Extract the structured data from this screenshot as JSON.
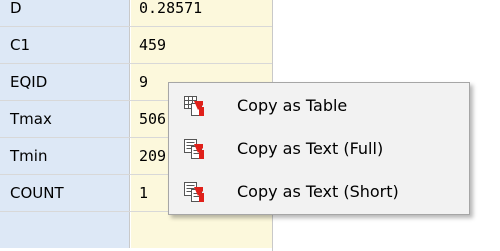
{
  "grid": {
    "rows": [
      {
        "name": "D",
        "value": "0.28571"
      },
      {
        "name": "C1",
        "value": "459"
      },
      {
        "name": "EQID",
        "value": "9"
      },
      {
        "name": "Tmax",
        "value": "506"
      },
      {
        "name": "Tmin",
        "value": "209"
      },
      {
        "name": "COUNT",
        "value": "1"
      }
    ]
  },
  "context_menu": {
    "items": [
      {
        "label": "Copy as Table",
        "icon": "table-copy-icon"
      },
      {
        "label": "Copy as Text (Full)",
        "icon": "text-copy-icon"
      },
      {
        "label": "Copy as Text (Short)",
        "icon": "text-copy-icon"
      }
    ]
  },
  "colors": {
    "name_column_bg": "#dde8f6",
    "value_column_bg": "#fcf8dc",
    "menu_bg": "#f2f2f2",
    "icon_accent": "#e0201a"
  }
}
